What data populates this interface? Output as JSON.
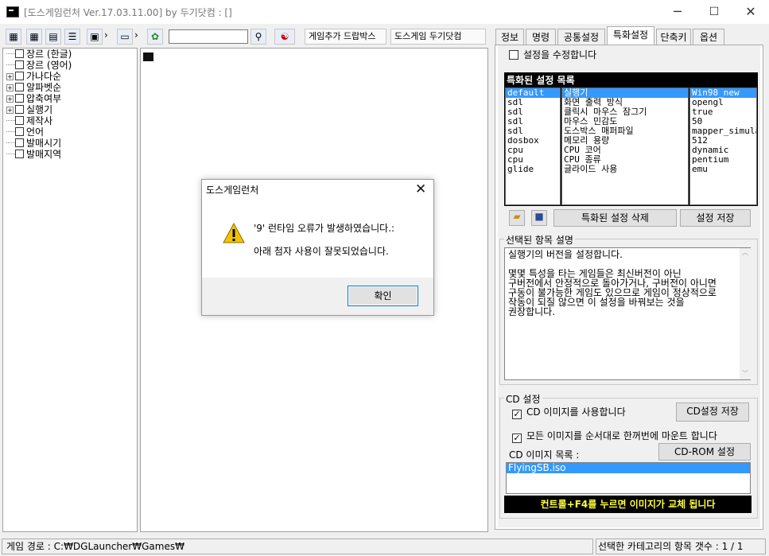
{
  "window": {
    "title": "[도스게임런처 Ver.17.03.11.00] by 두기닷컴 : []",
    "minimize": "─",
    "maximize": "☐",
    "close": "✕"
  },
  "toolbar": {
    "add_game_label": "게임추가 드랍박스",
    "site_label": "도스게임 두기닷컴",
    "search_value": ""
  },
  "tree": {
    "items": [
      {
        "label": "장르 (한글)",
        "expander": false
      },
      {
        "label": "장르 (영어)",
        "expander": false
      },
      {
        "label": "가나다순",
        "expander": true
      },
      {
        "label": "알파벳순",
        "expander": true
      },
      {
        "label": "압축여부",
        "expander": true
      },
      {
        "label": "실행기",
        "expander": true
      },
      {
        "label": "제작사",
        "expander": false
      },
      {
        "label": "언어",
        "expander": false
      },
      {
        "label": "발매시기",
        "expander": false
      },
      {
        "label": "발매지역",
        "expander": false
      }
    ]
  },
  "tabs": [
    "정보",
    "명령",
    "공통설정",
    "특화설정",
    "단축키",
    "옵션"
  ],
  "active_tab": 3,
  "settings": {
    "modify_checkbox": "설정을 수정합니다",
    "list_title": "특화된 설정 목록",
    "col1": [
      "default",
      "sdl",
      "sdl",
      "sdl",
      "sdl",
      "dosbox",
      "cpu",
      "cpu",
      "glide"
    ],
    "col2": [
      "실행기",
      "화면 출력 방식",
      "클릭시 마우스 잠그기",
      "마우스 민감도",
      "도스박스 매퍼파일",
      "메모리 용량",
      "CPU 코어",
      "CPU 종류",
      "글라이드 사용"
    ],
    "col3": [
      "Win98_new",
      "opengl",
      "true",
      "50",
      "mapper_simula",
      "512",
      "dynamic",
      "pentium",
      "emu"
    ],
    "delete_button": "특화된 설정 삭제",
    "save_button": "설정 저장",
    "desc_group": "선택된 항목 설명",
    "description": "실행기의 버전을 설정합니다.\n\n몇몇 특성을 타는 게임들은 최신버전이 아닌\n구버전에서 안정적으로 돌아가거나, 구버전이 아니면\n구동이 불가능한 게임도 있으므로 게임이 정상적으로\n작동이 되질 않으면 이 설정을 바꿔보는 것을\n권장합니다."
  },
  "cd": {
    "group": "CD 설정",
    "use_image": "CD 이미지를 사용합니다",
    "save_button": "CD설정 저장",
    "mount_all": "모든 이미지를 순서대로 한꺼번에 마운트 합니다",
    "list_label": "CD 이미지 목록 :",
    "rom_button": "CD-ROM 설정",
    "images": [
      "FlyingSB.iso"
    ],
    "notice": "컨트롤+F4를 누르면 이미지가 교체 됩니다"
  },
  "status": {
    "left": "게임 경로 : C:₩DGLauncher₩Games₩",
    "right": "선택한 카테고리의 항목 갯수 : 1 / 1"
  },
  "dialog": {
    "title": "도스게임런처",
    "line1": "'9' 런타임 오류가 발생하였습니다.:",
    "line2": "아래 첨자 사용이 잘못되었습니다.",
    "ok": "확인"
  },
  "colors": {
    "accent": "#3399ff",
    "notice_text": "#ffff33"
  }
}
